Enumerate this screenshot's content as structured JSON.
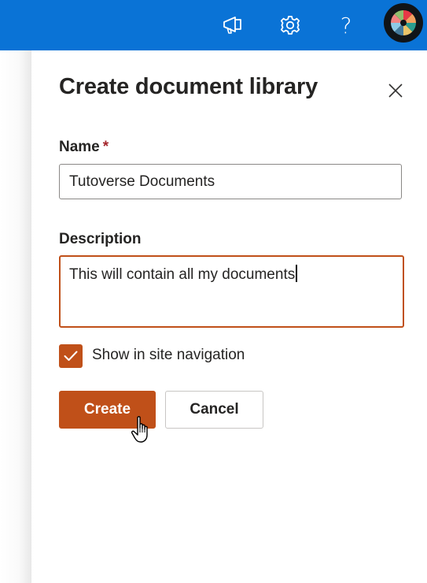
{
  "topbar": {
    "icons": [
      "megaphone-icon",
      "gear-icon",
      "help-icon"
    ],
    "help_glyph": "?",
    "accent": "#0a73d6"
  },
  "panel": {
    "title": "Create document library",
    "name_label": "Name",
    "required_mark": "*",
    "name_value": "Tutoverse Documents",
    "description_label": "Description",
    "description_value": "This will contain all my documents",
    "show_in_nav_label": "Show in site navigation",
    "show_in_nav_checked": true,
    "create_label": "Create",
    "cancel_label": "Cancel",
    "brand_color": "#c05019"
  }
}
